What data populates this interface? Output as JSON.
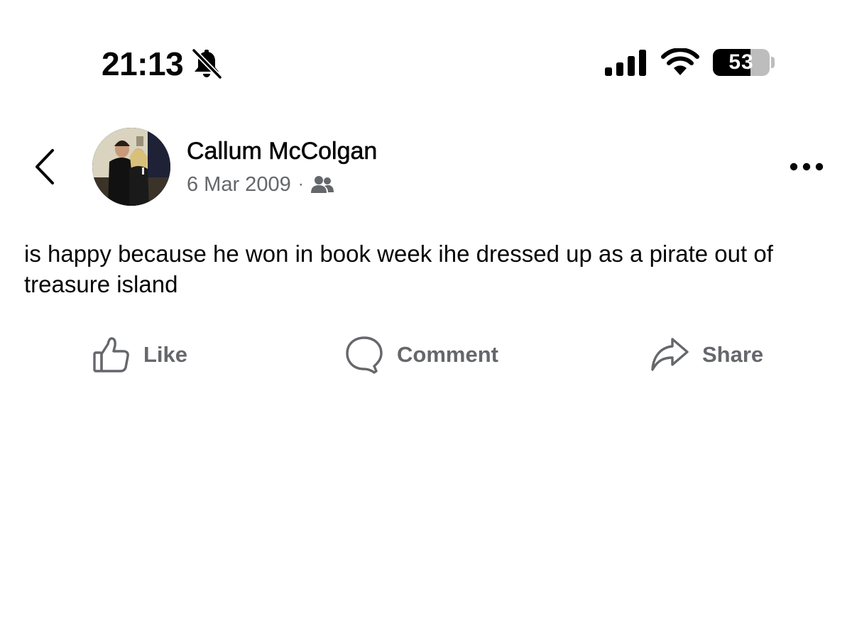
{
  "status_bar": {
    "time": "21:13",
    "battery_level": "53",
    "icons": [
      "bell-slash-icon",
      "cellular-signal-icon",
      "wifi-icon",
      "battery-icon"
    ]
  },
  "post": {
    "author": "Callum McColgan",
    "date": "6 Mar 2009",
    "separator": "·",
    "audience_icon": "friends-icon",
    "text": "is happy because he won in book week ihe dressed up as a pirate out of treasure island"
  },
  "actions": {
    "like": "Like",
    "comment": "Comment",
    "share": "Share"
  },
  "colors": {
    "text_primary": "#050505",
    "text_secondary": "#65676b",
    "background": "#ffffff"
  }
}
